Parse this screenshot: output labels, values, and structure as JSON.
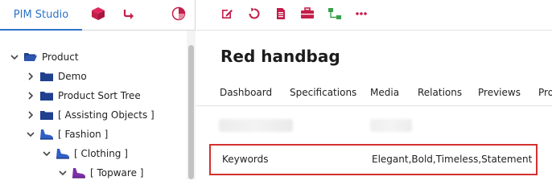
{
  "left_panel": {
    "tabs": [
      {
        "label": "PIM Studio",
        "active": true
      },
      {
        "icon": "cube-icon"
      },
      {
        "icon": "redirect-arrow-icon"
      },
      {
        "icon": "pie-chart-icon"
      }
    ],
    "tree": [
      {
        "label": "Product",
        "icon": "folder-open-icon",
        "expanded": true
      },
      {
        "label": "Demo",
        "icon": "folder-icon",
        "expanded": false
      },
      {
        "label": "Product Sort Tree",
        "icon": "folder-icon",
        "expanded": false
      },
      {
        "label": "[ Assisting Objects ]",
        "icon": "folder-icon",
        "expanded": false
      },
      {
        "label": "[ Fashion ]",
        "icon": "shoe-icon",
        "expanded": true
      },
      {
        "label": "[ Clothing ]",
        "icon": "shoe-icon",
        "expanded": true
      },
      {
        "label": "[ Topware ]",
        "icon": "shoe-icon",
        "expanded": true
      }
    ]
  },
  "toolbar": {
    "buttons": [
      "edit-icon",
      "reload-icon",
      "document-icon",
      "briefcase-icon",
      "hierarchy-icon",
      "more-icon"
    ]
  },
  "object": {
    "title": "Red handbag"
  },
  "tabs": [
    "Dashboard",
    "Specifications",
    "Media",
    "Relations",
    "Previews",
    "Pro"
  ],
  "keywords": {
    "label": "Keywords",
    "value": "Elegant,Bold,Timeless,Statement"
  },
  "colors": {
    "accent": "#c41e4a",
    "tab_active": "#2f73c8",
    "folder": "#1f3f8f",
    "highlight_border": "#d43030"
  }
}
